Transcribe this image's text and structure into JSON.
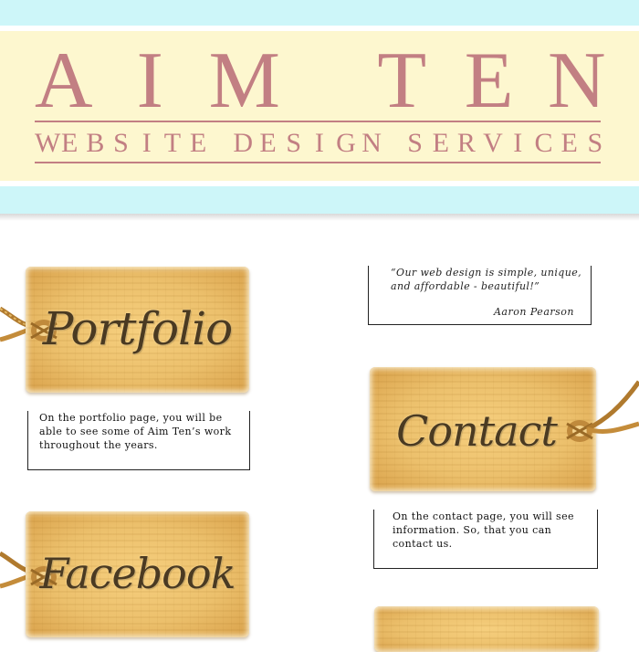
{
  "header": {
    "title": "AIM TEN",
    "subtitle": "WEBSITE DESIGN SERVICES"
  },
  "nav": {
    "portfolio": {
      "label": "Portfolio",
      "description": "On the portfolio page, you will be able to see some of Aim Ten’s work throughout the years."
    },
    "contact": {
      "label": "Contact",
      "description": "On the contact page, you will see information. So, that you can contact us."
    },
    "facebook": {
      "label": "Facebook"
    }
  },
  "testimonial": {
    "quote": "“Our web design is simple, unique, and affordable - beautiful!”",
    "author": "Aaron Pearson"
  },
  "colors": {
    "band_cyan": "#cdf6f9",
    "band_cream": "#fdf7cf",
    "brand_rose": "#c27f83",
    "tag_kraft": "#ecc06c",
    "tag_ink": "#4a3a22"
  },
  "icons": {
    "tag": "kraft-paper-hang-tag",
    "string": "twine-string"
  }
}
